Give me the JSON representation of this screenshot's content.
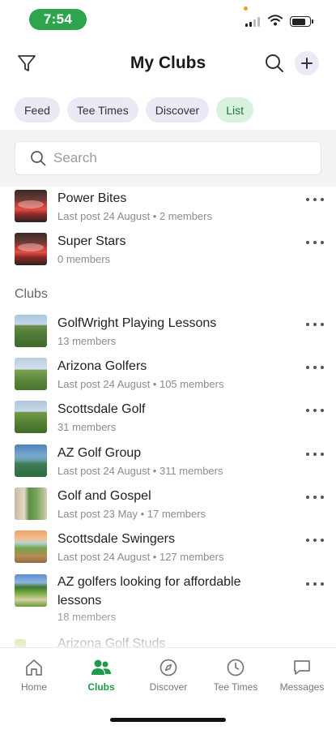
{
  "status_bar": {
    "time": "7:54"
  },
  "header": {
    "title": "My Clubs"
  },
  "chips": [
    {
      "label": "Feed",
      "active": false
    },
    {
      "label": "Tee Times",
      "active": false
    },
    {
      "label": "Discover",
      "active": false
    },
    {
      "label": "List",
      "active": true
    }
  ],
  "search": {
    "placeholder": "Search"
  },
  "groups": [
    {
      "title": "Power Bites",
      "subtitle": "Last post 24 August • 2 members"
    },
    {
      "title": "Super Stars",
      "subtitle": "0 members"
    }
  ],
  "clubs_section_label": "Clubs",
  "clubs": [
    {
      "title": "GolfWright Playing Lessons",
      "subtitle": "13 members"
    },
    {
      "title": "Arizona Golfers",
      "subtitle": "Last post 24 August • 105 members"
    },
    {
      "title": "Scottsdale Golf",
      "subtitle": "31 members"
    },
    {
      "title": "AZ Golf Group",
      "subtitle": "Last post 24 August • 311 members"
    },
    {
      "title": "Golf and Gospel",
      "subtitle": "Last post 23 May • 17 members"
    },
    {
      "title": "Scottsdale Swingers",
      "subtitle": "Last post 24 August • 127 members"
    },
    {
      "title": "AZ golfers looking for affordable lessons",
      "subtitle": "18 members"
    },
    {
      "title": "Arizona Golf Studs",
      "subtitle": ""
    }
  ],
  "tabbar": [
    {
      "label": "Home",
      "icon": "home-icon",
      "active": false
    },
    {
      "label": "Clubs",
      "icon": "clubs-icon",
      "active": true
    },
    {
      "label": "Discover",
      "icon": "compass-icon",
      "active": false
    },
    {
      "label": "Tee Times",
      "icon": "clock-icon",
      "active": false
    },
    {
      "label": "Messages",
      "icon": "message-icon",
      "active": false
    }
  ],
  "colors": {
    "accent": "#1f9a4a",
    "time_pill": "#2ea44f",
    "chip_bg": "#eaeaf6",
    "chip_active_bg": "#d8f2df"
  }
}
